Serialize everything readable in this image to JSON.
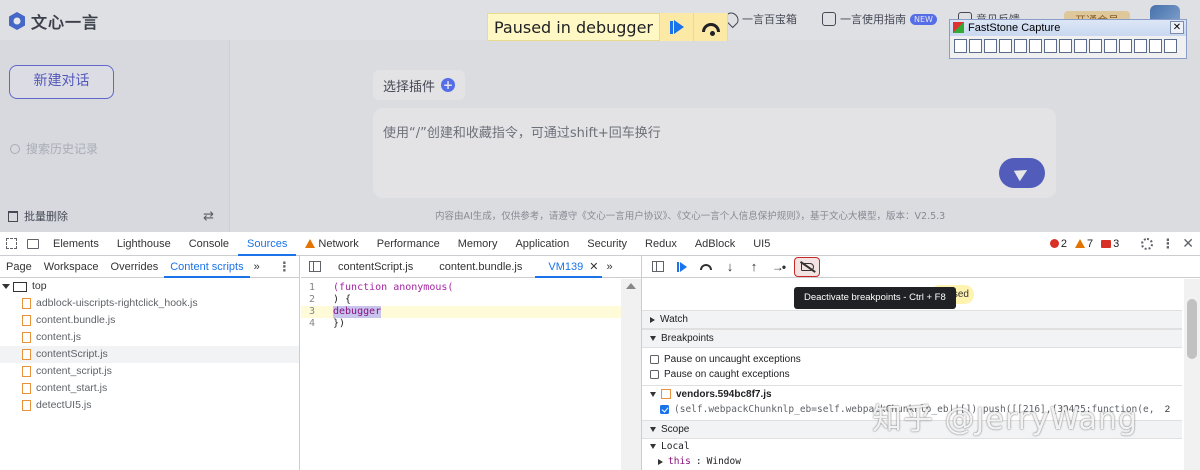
{
  "webpage": {
    "logo_text": "文心一言",
    "header_links": [
      {
        "label": "一言百宝箱",
        "icon": "pin-icon"
      },
      {
        "label": "一言使用指南",
        "icon": "book-icon",
        "badge": "NEW"
      },
      {
        "label": "意见反馈",
        "icon": "mail-icon"
      }
    ],
    "header_button": "开通会员",
    "sidebar": {
      "new_chat_label": "新建对话",
      "search_placeholder": "搜索历史记录",
      "batch_delete_label": "批量删除"
    },
    "plugin_chip_label": "选择插件",
    "prompt_placeholder": "使用“/”创建和收藏指令，可通过shift+回车换行",
    "disclaimer": "内容由AI生成，仅供参考，请遵守《文心一言用户协议》、《文心一言个人信息保护规则》，基于文心大模型，版本：V2.5.3"
  },
  "paused_banner": {
    "text": "Paused in debugger",
    "buttons": [
      "resume-icon",
      "step-over-icon"
    ]
  },
  "faststone": {
    "title": "FastStone Capture",
    "tool_count": 15
  },
  "devtools": {
    "tabs": [
      "Elements",
      "Lighthouse",
      "Console",
      "Sources",
      "Network",
      "Performance",
      "Memory",
      "Application",
      "Security",
      "Redux",
      "AdBlock",
      "UI5"
    ],
    "active_tab": "Sources",
    "network_warning": true,
    "counts": {
      "errors": "2",
      "warnings": "7",
      "issues": "3"
    },
    "navigator": {
      "tabs": [
        "Page",
        "Workspace",
        "Overrides",
        "Content scripts"
      ],
      "active_tab": "Content scripts",
      "more": "»",
      "root": "top",
      "files": [
        "adblock-uiscripts-rightclick_hook.js",
        "content.bundle.js",
        "content.js",
        "contentScript.js",
        "content_script.js",
        "content_start.js",
        "detectUI5.js"
      ],
      "selected_file": "contentScript.js"
    },
    "editor": {
      "tabs": [
        "contentScript.js",
        "content.bundle.js",
        "VM139"
      ],
      "active_tab": "VM139",
      "more": "»",
      "lines": [
        {
          "n": "1",
          "text": "(function anonymous("
        },
        {
          "n": "2",
          "text": ") {"
        },
        {
          "n": "3",
          "text": "debugger"
        },
        {
          "n": "4",
          "text": "})"
        }
      ]
    },
    "debugger": {
      "tooltip": "Deactivate breakpoints - Ctrl + F8",
      "paused_pill": "sed",
      "sections": {
        "watch": "Watch",
        "breakpoints": "Breakpoints",
        "pause_uncaught": "Pause on uncaught exceptions",
        "pause_caught": "Pause on caught exceptions",
        "bp_file": "vendors.594bc8f7.js",
        "bp_code": "(self.webpackChunknlp_eb=self.webpackChunknlp_eb||[]).push([[216],{30425:function(e,",
        "bp_line": "2",
        "scope": "Scope",
        "local": "Local",
        "this_key": "this",
        "this_value": "Window"
      }
    }
  },
  "watermark": "知乎 @JerryWang"
}
